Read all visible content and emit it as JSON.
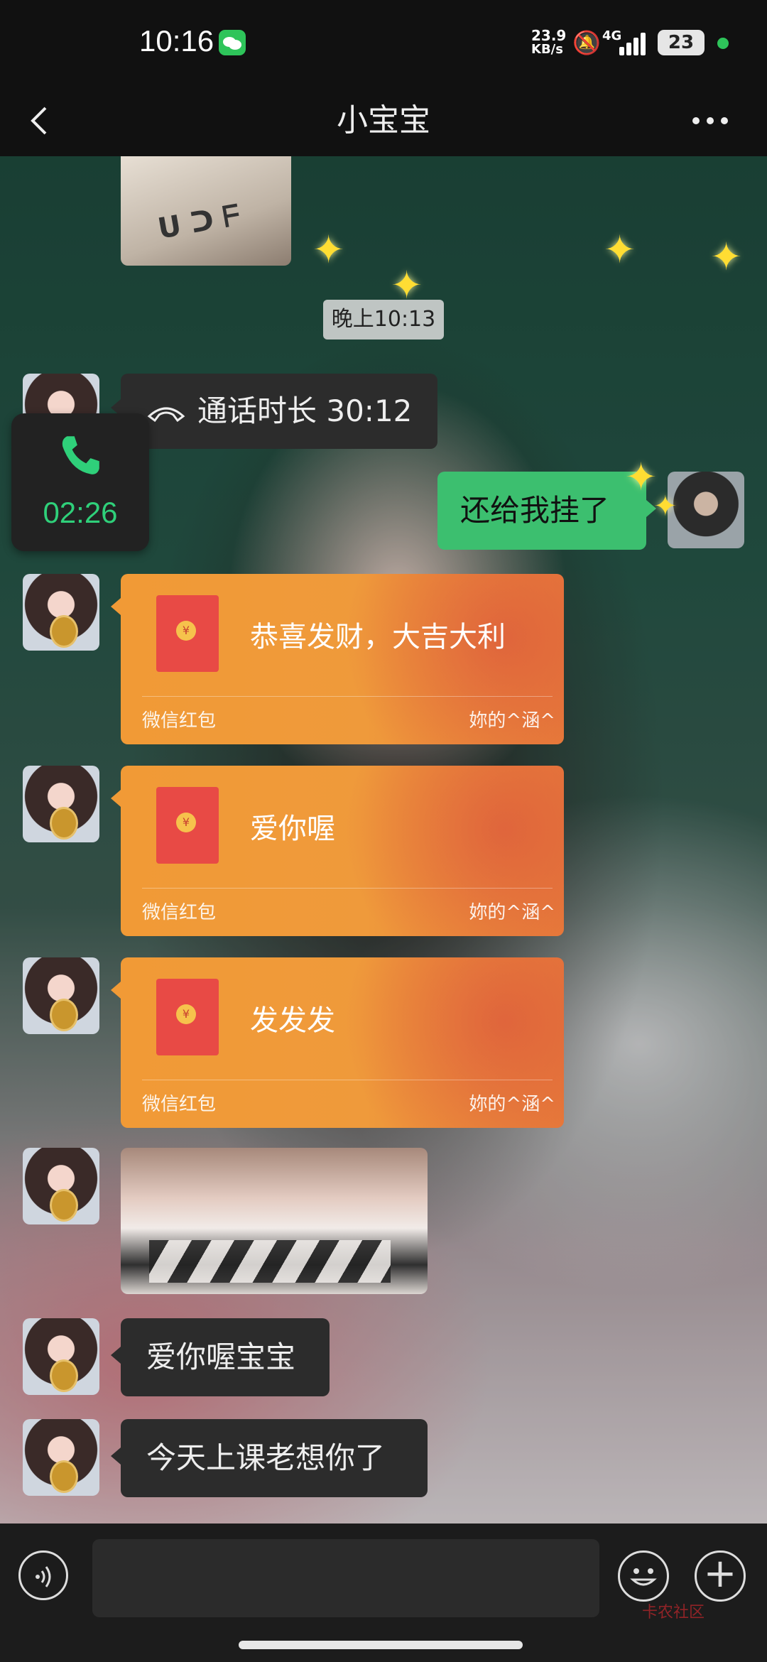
{
  "status_bar": {
    "time": "10:16",
    "net_speed": "23.9\nKB/s",
    "network": "4G",
    "battery": "23"
  },
  "header": {
    "title": "小宝宝",
    "back_icon": "chevron-left-icon",
    "more_icon": "more-dots-icon"
  },
  "chat": {
    "timestamp": "晚上10:13",
    "call_record": "通话时长 30:12",
    "my_message": "还给我挂了",
    "red_packets": [
      {
        "message": "恭喜发财，大吉大利",
        "brand": "微信红包",
        "sender": "妳的^涵^"
      },
      {
        "message": "爱你喔",
        "brand": "微信红包",
        "sender": "妳的^涵^"
      },
      {
        "message": "发发发",
        "brand": "微信红包",
        "sender": "妳的^涵^"
      }
    ],
    "texts": [
      "爱你喔宝宝",
      "今天上课老想你了"
    ]
  },
  "call_overlay": {
    "duration": "02:26"
  },
  "composer": {
    "placeholder": ""
  },
  "watermark": "卡农社区",
  "colors": {
    "accent_green": "#3cbf6f",
    "red_packet": "#f19a36",
    "call_green": "#2fd07a"
  }
}
